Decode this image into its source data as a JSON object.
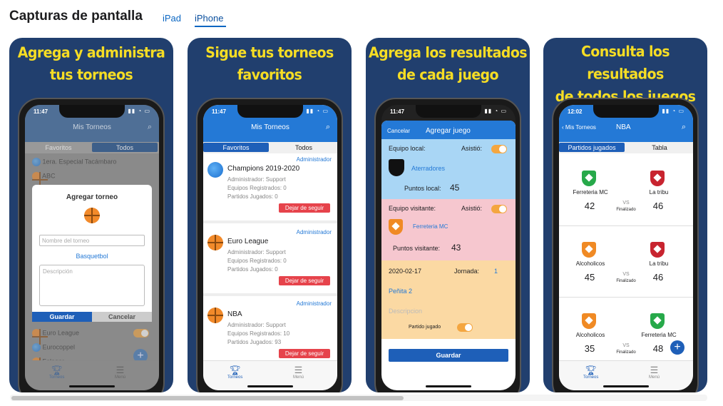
{
  "header": {
    "title": "Capturas de pantalla",
    "tabs": [
      {
        "label": "iPad"
      },
      {
        "label": "iPhone"
      }
    ]
  },
  "colors": {
    "card_bg": "#213f6e",
    "caption": "#f6dd24",
    "accent": "#2479d6",
    "red": "#e6434b"
  },
  "screens": [
    {
      "caption": [
        "Agrega y administra",
        "tus torneos"
      ],
      "time": "11:47",
      "nav_title": "Mis Torneos",
      "seg": [
        "Favoritos",
        "Todos"
      ],
      "list": [
        "1era. Especial Tacámbaro",
        "ABC"
      ],
      "dialog": {
        "title": "Agregar torneo",
        "name_placeholder": "Nombre del torneo",
        "sport": "Basquetbol",
        "desc_placeholder": "Descripción",
        "save": "Guardar",
        "cancel": "Cancelar"
      },
      "list_bottom": [
        "Euro League",
        "Eurocoppel",
        "Falagar"
      ],
      "tabs": [
        "Torneos",
        "Menú"
      ]
    },
    {
      "caption": [
        "Sigue tus torneos",
        "favoritos"
      ],
      "time": "11:47",
      "nav_title": "Mis Torneos",
      "seg": [
        "Favoritos",
        "Todos"
      ],
      "items": [
        {
          "role": "Administrador",
          "name": "Champions 2019-2020",
          "admin": "Administrador: Support",
          "teams": "Equipos Registrados: 0",
          "played": "Partidos Jugados: 0",
          "button": "Dejar de seguir"
        },
        {
          "role": "Administrador",
          "name": "Euro League",
          "admin": "Administrador: Support",
          "teams": "Equipos Registrados: 0",
          "played": "Partidos Jugados: 0",
          "button": "Dejar de seguir"
        },
        {
          "role": "Administrador",
          "name": "NBA",
          "admin": "Administrador: Support",
          "teams": "Equipos Registrados: 10",
          "played": "Partidos Jugados: 93",
          "button": "Dejar de seguir"
        }
      ],
      "tabs": [
        "Torneos",
        "Menú"
      ]
    },
    {
      "caption": [
        "Agrega los resultados",
        "de cada juego"
      ],
      "time": "11:47",
      "cancel": "Cancelar",
      "nav_title": "Agregar juego",
      "local": {
        "label": "Equipo local:",
        "attended": "Asistió:",
        "team": "Aterradores",
        "points_label": "Puntos local:",
        "points": "45"
      },
      "visitor": {
        "label": "Equipo visitante:",
        "attended": "Asistió:",
        "team": "Ferreteria MC",
        "points_label": "Puntos visitante:",
        "points": "43"
      },
      "info": {
        "date": "2020-02-17",
        "round_label": "Jornada:",
        "round": "1",
        "venue": "Peñita 2",
        "desc_placeholder": "Descripcion",
        "played": "Partido jugado"
      },
      "save": "Guardar"
    },
    {
      "caption": [
        "Consulta los resultados",
        "de todos los juegos"
      ],
      "time": "12:02",
      "back": "Mis Torneos",
      "nav_title": "NBA",
      "seg": [
        "Partidos jugados",
        "Tabla"
      ],
      "games": [
        {
          "home": "Ferreteria MC",
          "away": "La tribu",
          "home_score": "42",
          "away_score": "46",
          "vs": "VS",
          "status": "Finalizado"
        },
        {
          "home": "Alcoholicos",
          "away": "La tribu",
          "home_score": "45",
          "away_score": "46",
          "vs": "VS",
          "status": "Finalizado"
        },
        {
          "home": "Alcoholicos",
          "away": "Ferreteria MC",
          "home_score": "35",
          "away_score": "48",
          "vs": "VS",
          "status": "Finalizado"
        }
      ],
      "tabs": [
        "Torneos",
        "Menú"
      ]
    }
  ]
}
